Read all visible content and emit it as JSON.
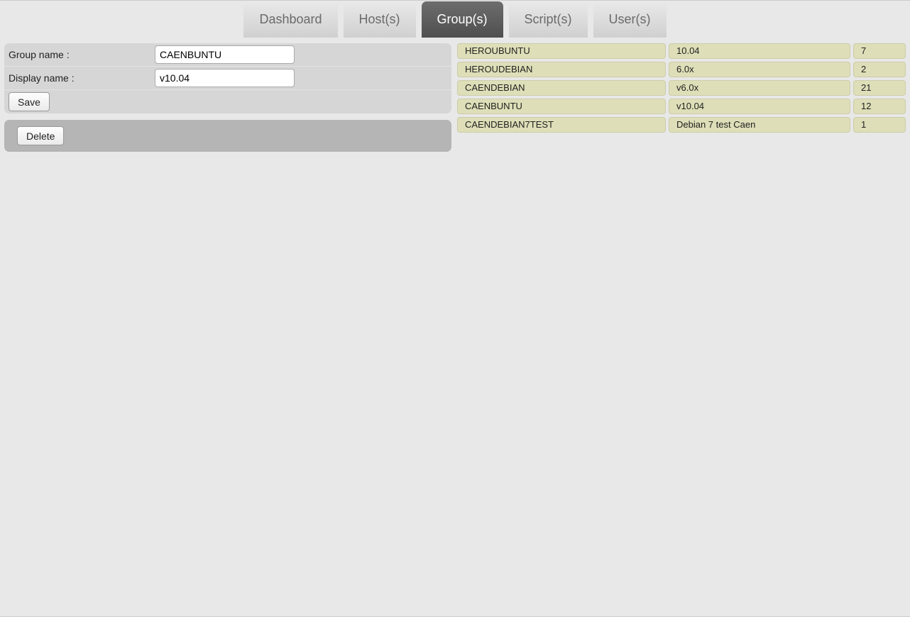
{
  "tabs": {
    "dashboard": "Dashboard",
    "hosts": "Host(s)",
    "groups": "Group(s)",
    "scripts": "Script(s)",
    "users": "User(s)",
    "active": "groups"
  },
  "form": {
    "group_name_label": "Group name :",
    "display_name_label": "Display name :",
    "group_name_value": "CAENBUNTU",
    "display_name_value": "v10.04",
    "save_label": "Save",
    "delete_label": "Delete"
  },
  "groups": [
    {
      "name": "HEROUBUNTU",
      "display": "10.04",
      "count": "7"
    },
    {
      "name": "HEROUDEBIAN",
      "display": "6.0x",
      "count": "2"
    },
    {
      "name": "CAENDEBIAN",
      "display": "v6.0x",
      "count": "21"
    },
    {
      "name": "CAENBUNTU",
      "display": "v10.04",
      "count": "12"
    },
    {
      "name": "CAENDEBIAN7TEST",
      "display": "Debian 7 test Caen",
      "count": "1"
    }
  ]
}
